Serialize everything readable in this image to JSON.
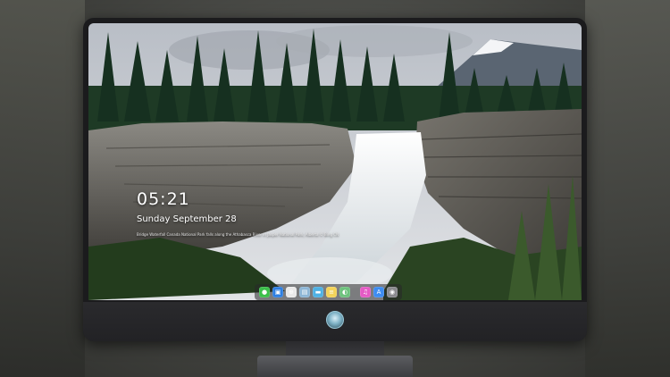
{
  "lockscreen": {
    "time": "05:21",
    "date": "Sunday September  28",
    "caption": "Bridge Waterfall Canada National Park falls along the Athabasca River in Jasper National Park, Alberta © Bing CN"
  },
  "dock": {
    "items": [
      {
        "name": "messages-icon",
        "color": "#3bbf4a",
        "glyph": "●"
      },
      {
        "name": "finder-icon",
        "color": "#2f7fe0",
        "glyph": "▣"
      },
      {
        "name": "safari-icon",
        "color": "#e9e9e9",
        "glyph": "⊕"
      },
      {
        "name": "preview-icon",
        "color": "#8db6d6",
        "glyph": "▤"
      },
      {
        "name": "folder-icon",
        "color": "#4fb1e3",
        "glyph": "▬"
      },
      {
        "name": "notes-icon",
        "color": "#f3d35a",
        "glyph": "≡"
      },
      {
        "name": "photos-icon",
        "color": "#6ec27e",
        "glyph": "◐"
      },
      {
        "name": "itunes-icon",
        "color": "#e45bc5",
        "glyph": "♫"
      },
      {
        "name": "app-store-icon",
        "color": "#3d8cf0",
        "glyph": "A"
      },
      {
        "name": "camera-icon",
        "color": "#8a8a8e",
        "glyph": "◉"
      }
    ]
  },
  "colors": {
    "sky": "#c8ccd2",
    "forest": "#1f3a26",
    "rock": "#6e6c66",
    "water": "#f2f4f6"
  }
}
